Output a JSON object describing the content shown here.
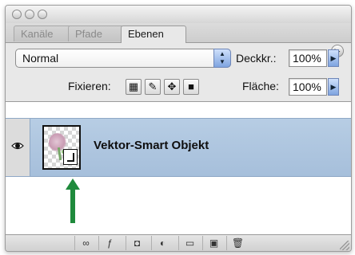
{
  "panel": {
    "tabs": [
      {
        "label": "Kanäle",
        "active": false
      },
      {
        "label": "Pfade",
        "active": false
      },
      {
        "label": "Ebenen",
        "active": true
      }
    ]
  },
  "blend": {
    "mode": "Normal",
    "opacity_label": "Deckkr.:",
    "opacity_value": "100%"
  },
  "lock": {
    "label": "Fixieren:",
    "fill_label": "Fläche:",
    "fill_value": "100%"
  },
  "layers": [
    {
      "name": "Vektor-Smart Objekt",
      "visible": true,
      "selected": true,
      "type": "smart-object"
    }
  ],
  "icons": {
    "annotation_arrow": "up-arrow-icon",
    "eye": "eye-icon"
  },
  "colors": {
    "selected_row": "#a9c1dc",
    "annotation_arrow": "#1f8a3c"
  }
}
